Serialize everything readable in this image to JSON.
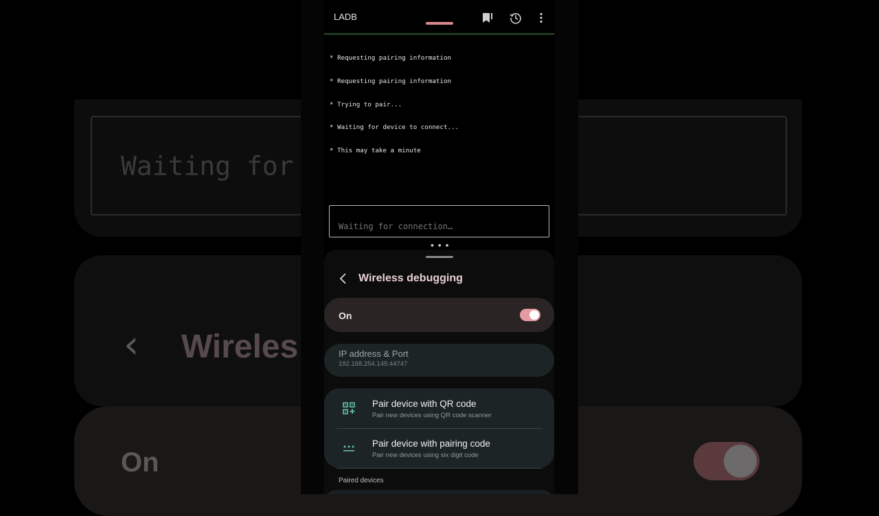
{
  "app": {
    "title": "LADB"
  },
  "appbar": {
    "bookmark_icon": "bookmark-icon",
    "history_icon": "history-icon",
    "more_icon": "more-vert-icon"
  },
  "terminal": {
    "lines": [
      "* Requesting pairing information",
      "* Requesting pairing information",
      "* Trying to pair...",
      "* Waiting for device to connect...",
      "* This may take a minute"
    ]
  },
  "command_input": {
    "placeholder": "Waiting for connection…"
  },
  "background": {
    "input_text": "Waiting for",
    "title": "Wireles",
    "on_text": "On"
  },
  "settings": {
    "title": "Wireless debugging",
    "toggle": {
      "label": "On",
      "checked": true,
      "accent": "#e39aa2"
    },
    "ip": {
      "label": "IP address & Port",
      "value": "192.168.254.145:44747"
    },
    "pair_items": [
      {
        "title": "Pair device with QR code",
        "subtitle": "Pair new devices using QR code scanner",
        "icon": "qr-code-icon"
      },
      {
        "title": "Pair device with pairing code",
        "subtitle": "Pair new devices using six digit code",
        "icon": "dialpad-icon"
      }
    ],
    "paired_devices_label": "Paired devices"
  },
  "colors": {
    "accent_green": "#1e3a20",
    "icon_teal": "#66c2b0",
    "title_pink": "#e8cfd2"
  }
}
